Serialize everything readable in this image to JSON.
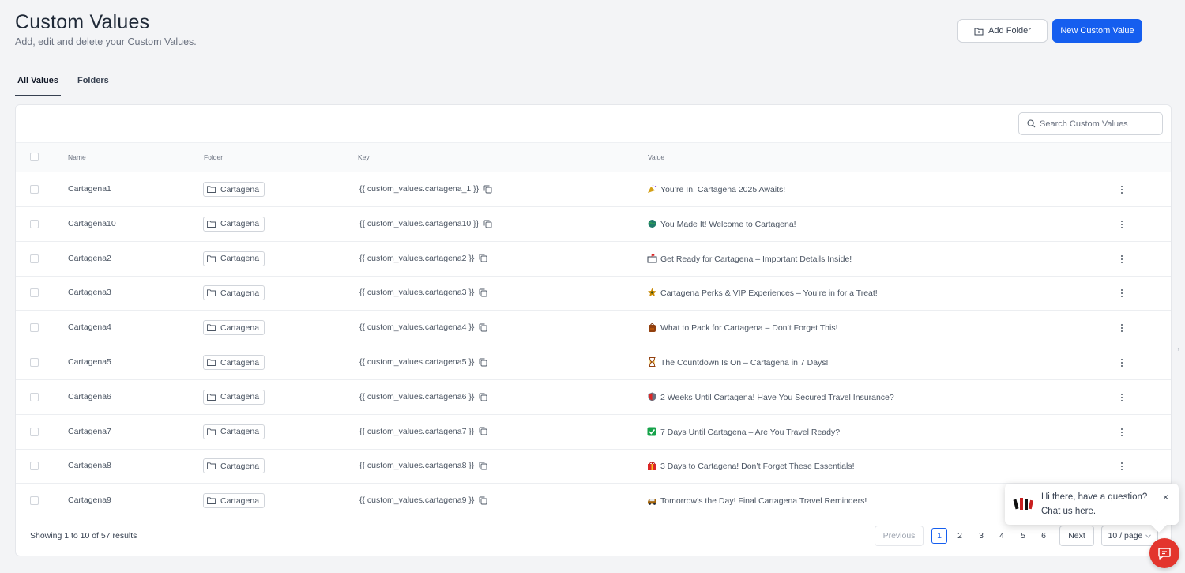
{
  "header": {
    "title": "Custom Values",
    "subtitle": "Add, edit and delete your Custom Values.",
    "add_folder_label": "Add Folder",
    "new_value_label": "New Custom Value"
  },
  "tabs": [
    {
      "label": "All Values",
      "active": true
    },
    {
      "label": "Folders",
      "active": false
    }
  ],
  "search": {
    "placeholder": "Search Custom Values"
  },
  "table": {
    "columns": {
      "name": "Name",
      "folder": "Folder",
      "key": "Key",
      "value": "Value"
    },
    "rows": [
      {
        "name": "Cartagena1",
        "folder": "Cartagena",
        "key": "{{ custom_values.cartagena_1 }}",
        "value": "You’re In! Cartagena 2025 Awaits!",
        "icon": "party-popper"
      },
      {
        "name": "Cartagena10",
        "folder": "Cartagena",
        "key": "{{ custom_values.cartagena10 }}",
        "value": "You Made It! Welcome to Cartagena!",
        "icon": "globe"
      },
      {
        "name": "Cartagena2",
        "folder": "Cartagena",
        "key": "{{ custom_values.cartagena2 }}",
        "value": "Get Ready for Cartagena – Important Details Inside!",
        "icon": "mailbox"
      },
      {
        "name": "Cartagena3",
        "folder": "Cartagena",
        "key": "{{ custom_values.cartagena3 }}",
        "value": "Cartagena Perks & VIP Experiences – You’re in for a Treat!",
        "icon": "sparkle"
      },
      {
        "name": "Cartagena4",
        "folder": "Cartagena",
        "key": "{{ custom_values.cartagena4 }}",
        "value": "What to Pack for Cartagena – Don’t Forget This!",
        "icon": "backpack"
      },
      {
        "name": "Cartagena5",
        "folder": "Cartagena",
        "key": "{{ custom_values.cartagena5 }}",
        "value": "The Countdown Is On – Cartagena in 7 Days!",
        "icon": "hourglass"
      },
      {
        "name": "Cartagena6",
        "folder": "Cartagena",
        "key": "{{ custom_values.cartagena6 }}",
        "value": "2 Weeks Until Cartagena! Have You Secured Travel Insurance?",
        "icon": "shield"
      },
      {
        "name": "Cartagena7",
        "folder": "Cartagena",
        "key": "{{ custom_values.cartagena7 }}",
        "value": "7 Days Until Cartagena – Are You Travel Ready?",
        "icon": "check-box"
      },
      {
        "name": "Cartagena8",
        "folder": "Cartagena",
        "key": "{{ custom_values.cartagena8 }}",
        "value": "3 Days to Cartagena! Don’t Forget These Essentials!",
        "icon": "gift"
      },
      {
        "name": "Cartagena9",
        "folder": "Cartagena",
        "key": "{{ custom_values.cartagena9 }}",
        "value": "Tomorrow’s the Day! Final Cartagena Travel Reminders!",
        "icon": "car"
      }
    ]
  },
  "footer": {
    "showing": "Showing 1 to 10 of 57 results",
    "previous": "Previous",
    "pages": [
      "1",
      "2",
      "3",
      "4",
      "5",
      "6"
    ],
    "current_page": "1",
    "next": "Next",
    "page_size": "10 / page"
  },
  "chat": {
    "line1": "Hi there, have a question?",
    "line2": "Chat us here.",
    "close": "×"
  },
  "colors": {
    "primary": "#155eef",
    "chat": "#e3352d"
  }
}
